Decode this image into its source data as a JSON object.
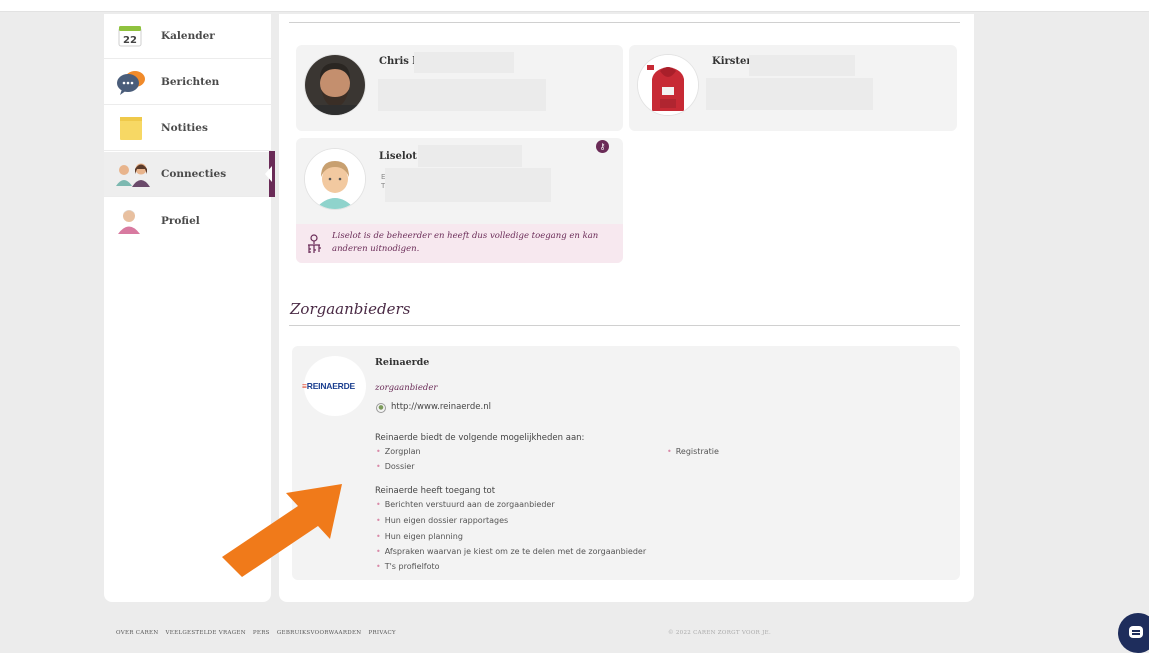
{
  "sidebar": {
    "items": [
      {
        "label": "Kalender",
        "icon": "calendar-icon",
        "badge": "22"
      },
      {
        "label": "Berichten",
        "icon": "chat-bubbles-icon"
      },
      {
        "label": "Notities",
        "icon": "sticky-note-icon"
      },
      {
        "label": "Connecties",
        "icon": "people-icon",
        "active": true
      },
      {
        "label": "Profiel",
        "icon": "user-icon"
      }
    ]
  },
  "connections": [
    {
      "name": "Chris l"
    },
    {
      "name": "Kirsten"
    },
    {
      "name": "Liselot S",
      "admin": true,
      "line1": "E",
      "line2": "T"
    }
  ],
  "admin_note": "Liselot is de beheerder en heeft dus volledige toegang en kan anderen uitnodigen.",
  "providers_section": {
    "title": "Zorgaanbieders"
  },
  "provider": {
    "name": "Reinaerde",
    "logo_text_mark": "≡",
    "logo_text": "REINAERDE",
    "type": "zorgaanbieder",
    "url": "http://www.reinaerde.nl",
    "offers_heading": "Reinaerde biedt de volgende mogelijkheden aan:",
    "offers_left": [
      "Zorgplan",
      "Dossier"
    ],
    "offers_right": [
      "Registratie"
    ],
    "access_heading": "Reinaerde heeft toegang tot",
    "access": [
      "Berichten verstuurd aan de zorgaanbieder",
      "Hun eigen dossier rapportages",
      "Hun eigen planning",
      "Afspraken waarvan je kiest om ze te delen met de zorgaanbieder",
      "T's profielfoto"
    ]
  },
  "footer": {
    "links": [
      "OVER CAREN",
      "VEELGESTELDE VRAGEN",
      "PERS",
      "GEBRUIKSVOORWAARDEN",
      "PRIVACY"
    ],
    "copyright": "© 2022 CAREN ZORGT VOOR JE."
  },
  "colors": {
    "accent": "#6a2b57",
    "arrow": "#f07a1a",
    "chat": "#1e2d5c"
  }
}
